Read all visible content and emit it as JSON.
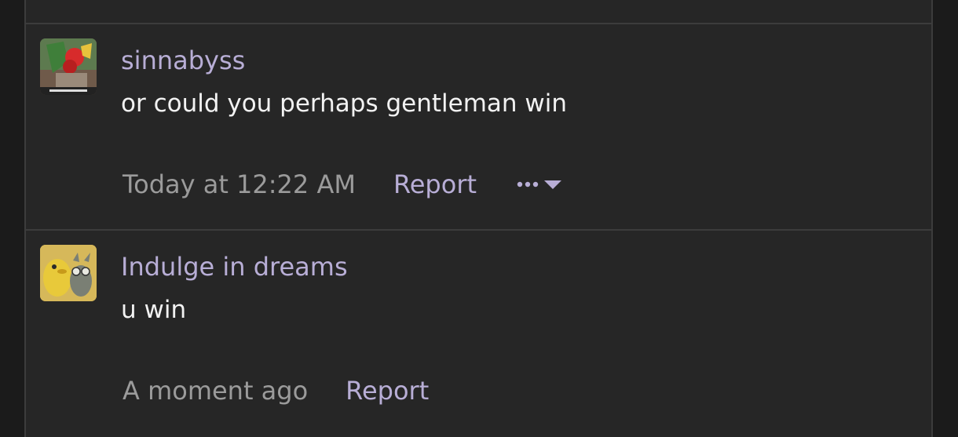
{
  "comments": [
    {
      "username": "sinnabyss",
      "text": "or could you perhaps gentleman win",
      "timestamp": "Today at 12:22 AM",
      "report_label": "Report",
      "more_icon": "ellipsis-icon",
      "dropdown_icon": "caret-down-icon"
    },
    {
      "username": "Indulge in dreams",
      "text": "u win",
      "timestamp": "A moment ago",
      "report_label": "Report"
    }
  ],
  "colors": {
    "background": "#262626",
    "border": "#3c3c3c",
    "username": "#b8aed6",
    "text": "#f2f2f2",
    "timestamp": "#9b9b9b",
    "link": "#b8aed6"
  }
}
